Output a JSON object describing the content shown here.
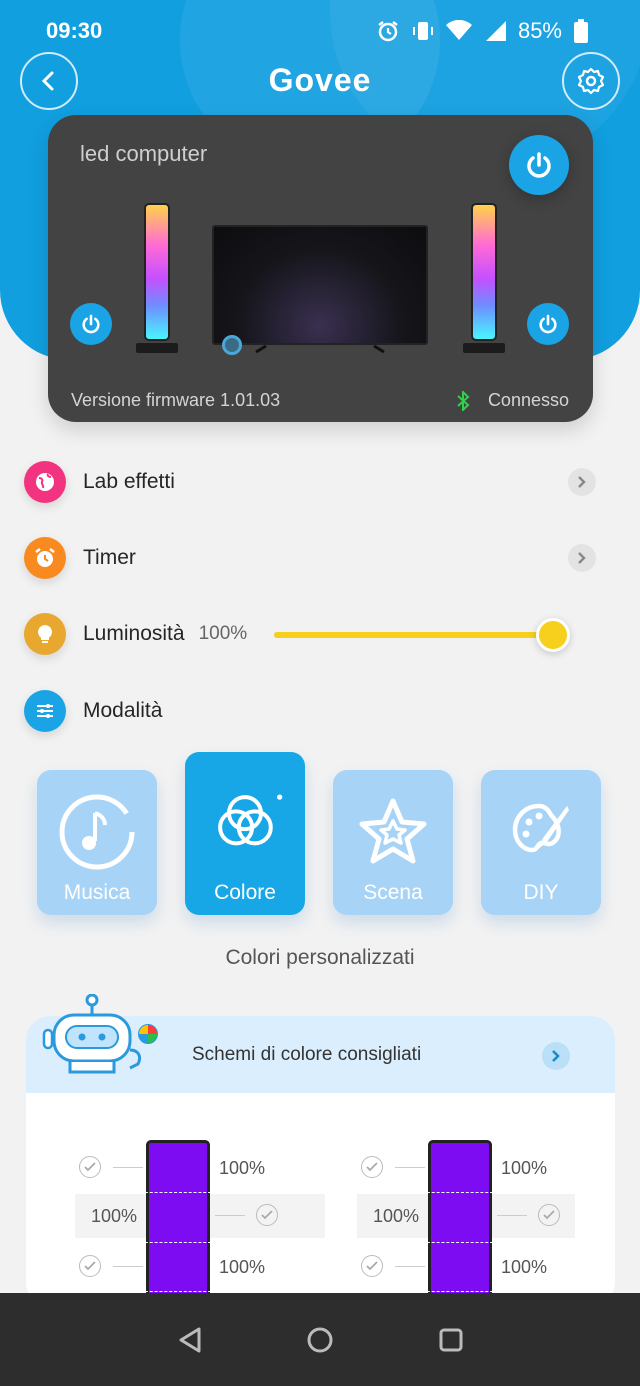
{
  "status": {
    "time": "09:30",
    "battery": "85%"
  },
  "header": {
    "logo": "Govee",
    "back_icon": "chevron-left-icon",
    "settings_icon": "gear-icon"
  },
  "device": {
    "name": "led computer",
    "firmware": "Versione firmware 1.01.03",
    "connection": "Connesso"
  },
  "menu": {
    "effects_lab": "Lab effetti",
    "timer": "Timer",
    "brightness_label": "Luminosità",
    "brightness_value": "100%",
    "brightness_level": 1.0,
    "mode": "Modalità"
  },
  "modes": [
    {
      "label": "Musica",
      "active": false
    },
    {
      "label": "Colore",
      "active": true
    },
    {
      "label": "Scena",
      "active": false
    },
    {
      "label": "DIY",
      "active": false
    }
  ],
  "custom_colors": {
    "title": "Colori personalizzati"
  },
  "recommended": {
    "title": "Schemi di colore consigliati"
  },
  "schemes": [
    {
      "top": "100%",
      "mid": "100%",
      "bottom": "100%"
    },
    {
      "top": "100%",
      "mid": "100%",
      "bottom": "100%"
    }
  ],
  "colors": {
    "accent": "#119fe0",
    "slider": "#f7cf1d",
    "scheme": "#7d0cf2"
  }
}
